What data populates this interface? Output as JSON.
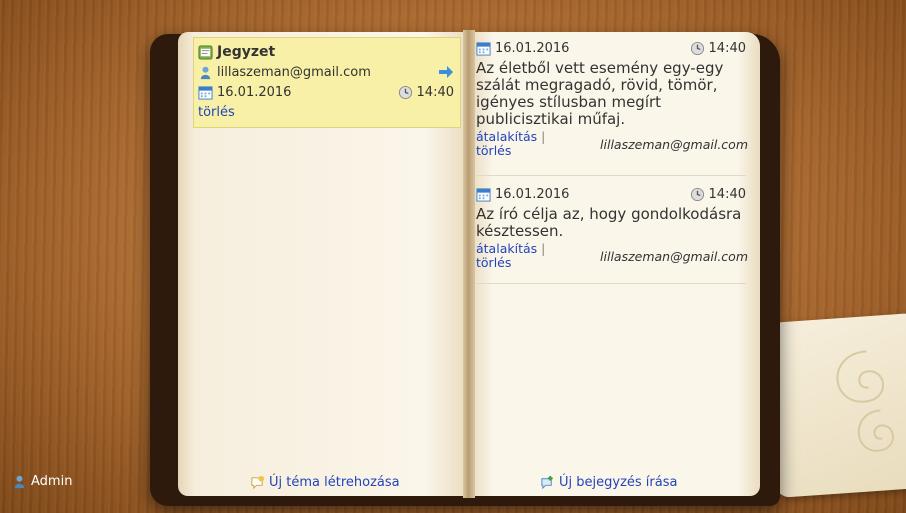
{
  "note": {
    "title": "Jegyzet",
    "email": "lillaszeman@gmail.com",
    "date": "16.01.2016",
    "time": "14:40",
    "delete_label": "törlés"
  },
  "entries": [
    {
      "date": "16.01.2016",
      "time": "14:40",
      "text": "Az életből vett esemény egy-egy szálát megragadó, rövid, tömör, igényes stílusban megírt publicisztikai műfaj.",
      "edit_label": "átalakítás",
      "separator": "|",
      "delete_label": "törlés",
      "author": "lillaszeman@gmail.com"
    },
    {
      "date": "16.01.2016",
      "time": "14:40",
      "text": "Az író célja az, hogy gondolkodásra késztessen.",
      "edit_label": "átalakítás",
      "separator": "|",
      "delete_label": "törlés",
      "author": "lillaszeman@gmail.com"
    }
  ],
  "footer": {
    "new_topic_label": "Új téma létrehozása",
    "new_entry_label": "Új bejegyzés írása",
    "user_label": "Admin"
  },
  "colors": {
    "link": "#2244bb",
    "note_background": "#f7f0a6"
  }
}
